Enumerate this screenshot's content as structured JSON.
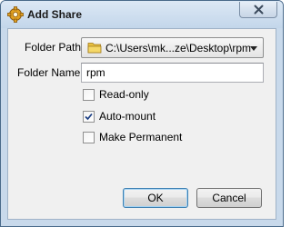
{
  "window": {
    "title": "Add Share",
    "icons": {
      "app": "gear-icon",
      "close": "close-icon"
    }
  },
  "form": {
    "folder_path_label": "Folder Path:",
    "folder_path_value": "C:\\Users\\mk...ze\\Desktop\\rpm",
    "folder_name_label": "Folder Name:",
    "folder_name_value": "rpm",
    "options": [
      {
        "label": "Read-only",
        "checked": false
      },
      {
        "label": "Auto-mount",
        "checked": true
      },
      {
        "label": "Make Permanent",
        "checked": false
      }
    ]
  },
  "buttons": {
    "ok_label": "OK",
    "cancel_label": "Cancel"
  },
  "colors": {
    "titlebar": "#c3d6ea",
    "client_bg": "#f0f0f0",
    "default_button_border": "#3c7fb1"
  }
}
